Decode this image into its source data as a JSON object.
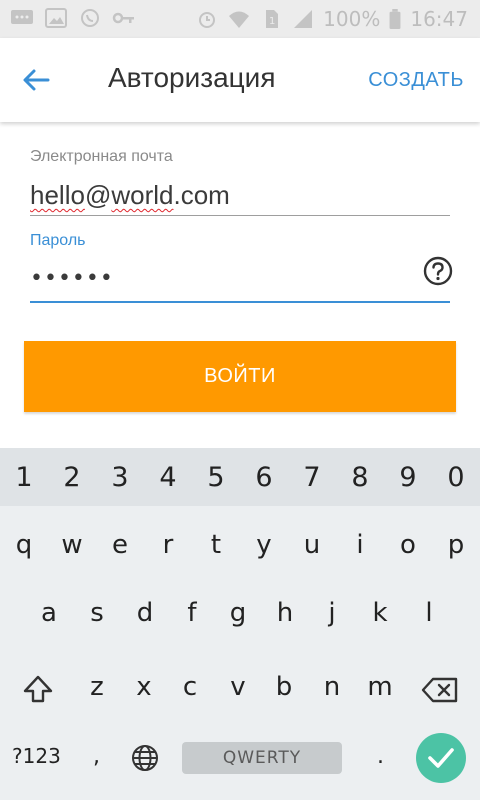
{
  "status_bar": {
    "battery": "100%",
    "time": "16:47",
    "icons": [
      "message-icon",
      "image-icon",
      "viber-icon",
      "key-icon",
      "alarm-icon",
      "wifi-icon",
      "sim-icon",
      "signal-icon",
      "battery-icon"
    ]
  },
  "app_bar": {
    "title": "Авторизация",
    "action": "СОЗДАТЬ",
    "back_icon": "arrow-left-icon",
    "accent": "#3a8fd6"
  },
  "form": {
    "email_label": "Электронная почта",
    "email_part1": "hello",
    "email_at": "@",
    "email_part2": "world",
    "email_part3": ".com",
    "password_label": "Пароль",
    "password_masked": "••••••",
    "help_icon": "question-circle-icon"
  },
  "login_button": {
    "label": "ВОЙТИ",
    "color": "#ff9900"
  },
  "keyboard": {
    "numbers": [
      "1",
      "2",
      "3",
      "4",
      "5",
      "6",
      "7",
      "8",
      "9",
      "0"
    ],
    "row1": [
      "q",
      "w",
      "e",
      "r",
      "t",
      "y",
      "u",
      "i",
      "o",
      "p"
    ],
    "row2": [
      "a",
      "s",
      "d",
      "f",
      "g",
      "h",
      "j",
      "k",
      "l"
    ],
    "row3": [
      "z",
      "x",
      "c",
      "v",
      "b",
      "n",
      "m"
    ],
    "symbols_key": "?123",
    "comma": ",",
    "space_label": "QWERTY",
    "period": ".",
    "enter_color": "#4cc3a5"
  }
}
